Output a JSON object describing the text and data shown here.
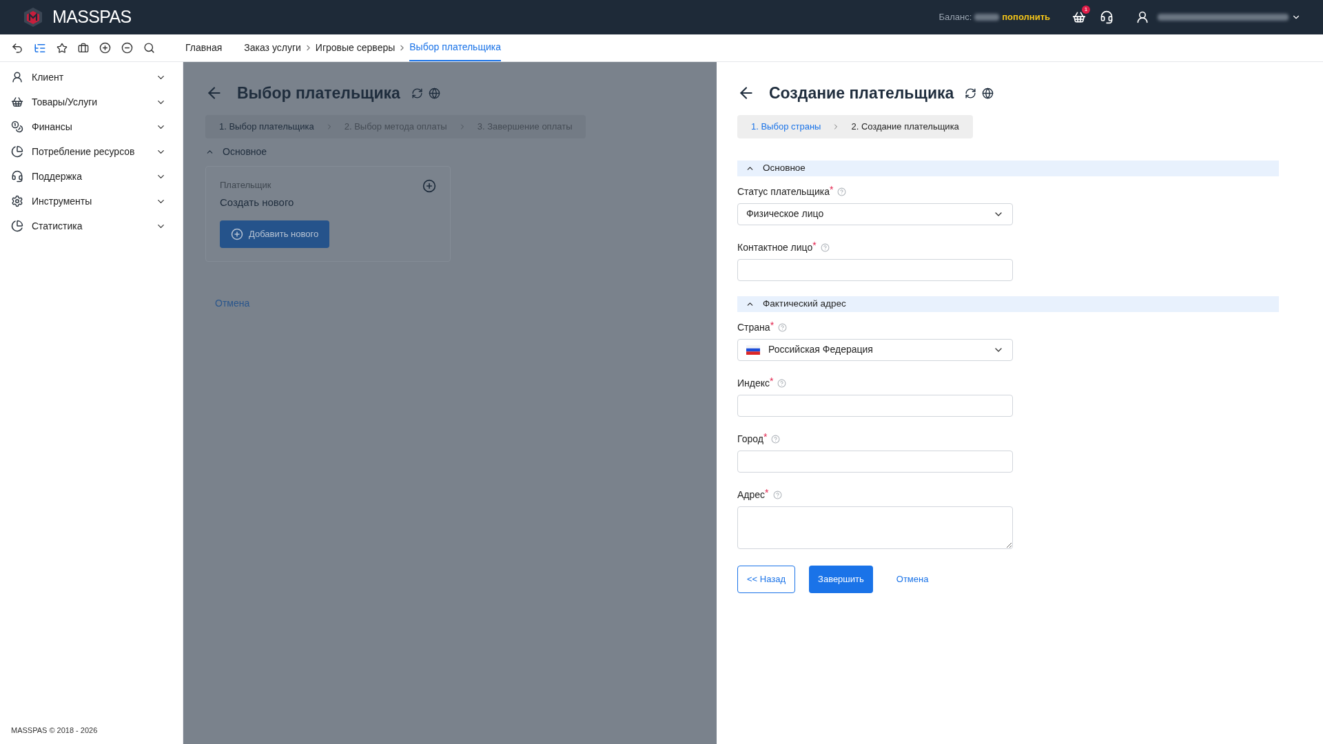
{
  "topbar": {
    "logo": "MASSPAS",
    "balance_label": "Баланс:",
    "topup_link": "пополнить",
    "cart_badge": "1"
  },
  "breadcrumbs": [
    {
      "label": "Главная",
      "selected": false
    },
    {
      "label": "Заказ услуги",
      "selected": false
    },
    {
      "label": "Игровые серверы",
      "selected": false
    },
    {
      "label": "Выбор плательщика",
      "selected": true
    }
  ],
  "sidebar": {
    "items": [
      {
        "label": "Клиент",
        "kind": "user",
        "expanded": false
      },
      {
        "label": "Товары/Услуги",
        "kind": "basket",
        "expanded": false
      },
      {
        "label": "Финансы",
        "kind": "coins",
        "expanded": false
      },
      {
        "label": "Потребление ресурсов",
        "kind": "pie",
        "expanded": false
      },
      {
        "label": "Поддержка",
        "kind": "headset",
        "expanded": false
      },
      {
        "label": "Инструменты",
        "kind": "gear",
        "expanded": false
      },
      {
        "label": "Статистика",
        "kind": "pie",
        "expanded": false
      }
    ],
    "footer": "MASSPAS © 2018 - 2026"
  },
  "background_panel": {
    "title": "Выбор плательщика",
    "steps": [
      {
        "label": "1. Выбор плательщика",
        "selected": true
      },
      {
        "label": "2. Выбор метода оплаты",
        "selected": false
      },
      {
        "label": "3. Завершение оплаты",
        "selected": false
      }
    ],
    "section": {
      "title": "Основное",
      "expanded": true
    },
    "card": {
      "label": "Плательщик",
      "value": "Создать нового",
      "button": "Добавить нового"
    },
    "cancel": "Отмена"
  },
  "form_panel": {
    "title": "Создание плательщика",
    "steps": [
      {
        "label": "1. Выбор страны",
        "selected": false
      },
      {
        "label": "2. Создание плательщика",
        "selected": true
      }
    ],
    "sections": [
      {
        "title": "Основное",
        "expanded": true,
        "fields": [
          {
            "kind": "select",
            "label": "Статус плательщика",
            "required_mark": "*",
            "value": "Физическое лицо"
          },
          {
            "kind": "text",
            "label": "Контактное лицо",
            "required_mark": "*"
          }
        ]
      },
      {
        "title": "Фактический адрес",
        "expanded": true,
        "fields": [
          {
            "kind": "country_select",
            "label": "Страна",
            "required_mark": "*",
            "value": "Российская Федерация"
          },
          {
            "kind": "text",
            "label": "Индекс",
            "required_mark": "*"
          },
          {
            "kind": "text",
            "label": "Город",
            "required_mark": "*"
          },
          {
            "kind": "textarea",
            "label": "Адрес",
            "required_mark": "*"
          }
        ]
      }
    ],
    "back_button": "<< Назад",
    "submit_button": "Завершить",
    "cancel": "Отмена"
  }
}
